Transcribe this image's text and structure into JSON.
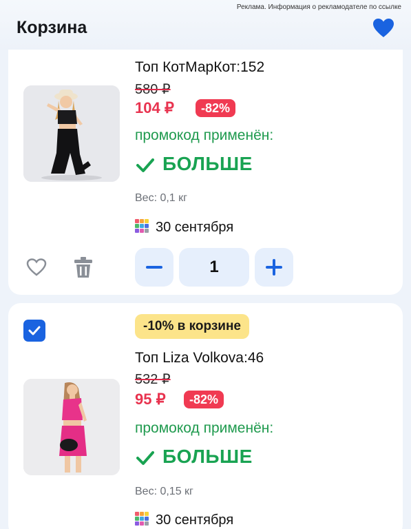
{
  "ad_note": "Реклама. Информация о рекламодателе по ссылке",
  "header": {
    "title": "Корзина"
  },
  "items": [
    {
      "name": "Топ КотМарКот:152",
      "old_price": "580 ₽",
      "new_price": "104 ₽",
      "discount": "-82%",
      "promo": "промокод применён:",
      "promo_more": "БОЛЬШЕ",
      "weight": "Вес: 0,1 кг",
      "delivery": "30 сентября",
      "quantity": "1"
    },
    {
      "cart_badge": "-10% в корзине",
      "name": "Топ Liza Volkova:46",
      "old_price": "532 ₽",
      "new_price": "95 ₽",
      "discount": "-82%",
      "promo": "промокод применён:",
      "promo_more": "БОЛЬШЕ",
      "weight": "Вес: 0,15 кг",
      "delivery": "30 сентября",
      "selected": true
    }
  ],
  "colors": {
    "accent": "#1a63e0",
    "price_red": "#e8334f",
    "promo_green": "#19a352",
    "badge_yellow": "#fce48a"
  },
  "icons": [
    "heart-icon",
    "trash-icon",
    "minus-icon",
    "plus-icon",
    "check-icon",
    "calendar-grid-icon"
  ]
}
